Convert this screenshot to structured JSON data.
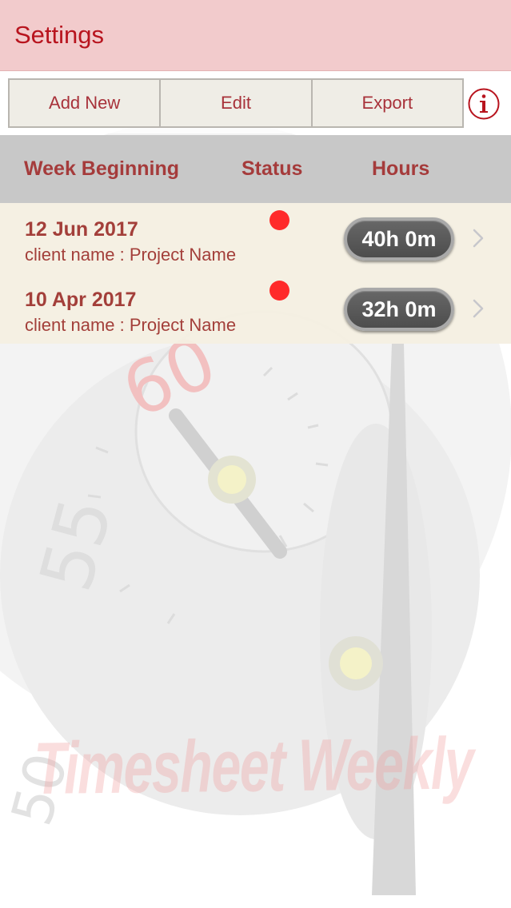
{
  "nav": {
    "settings_label": "Settings"
  },
  "toolbar": {
    "buttons": [
      {
        "label": "Add New"
      },
      {
        "label": "Edit"
      },
      {
        "label": "Export"
      }
    ],
    "info_icon": "info-icon"
  },
  "table": {
    "headers": {
      "week": "Week Beginning",
      "status": "Status",
      "hours": "Hours"
    },
    "rows": [
      {
        "date": "12 Jun 2017",
        "subtitle": "client name : Project Name",
        "status": "red",
        "hours": "40h 0m"
      },
      {
        "date": "10 Apr 2017",
        "subtitle": "client name : Project Name",
        "status": "red",
        "hours": "32h 0m"
      }
    ]
  },
  "watermark": "Timesheet Weekly",
  "colors": {
    "accent": "#b8141e",
    "nav_bg": "#f2cbcc",
    "status_red": "#ff2a2a"
  }
}
